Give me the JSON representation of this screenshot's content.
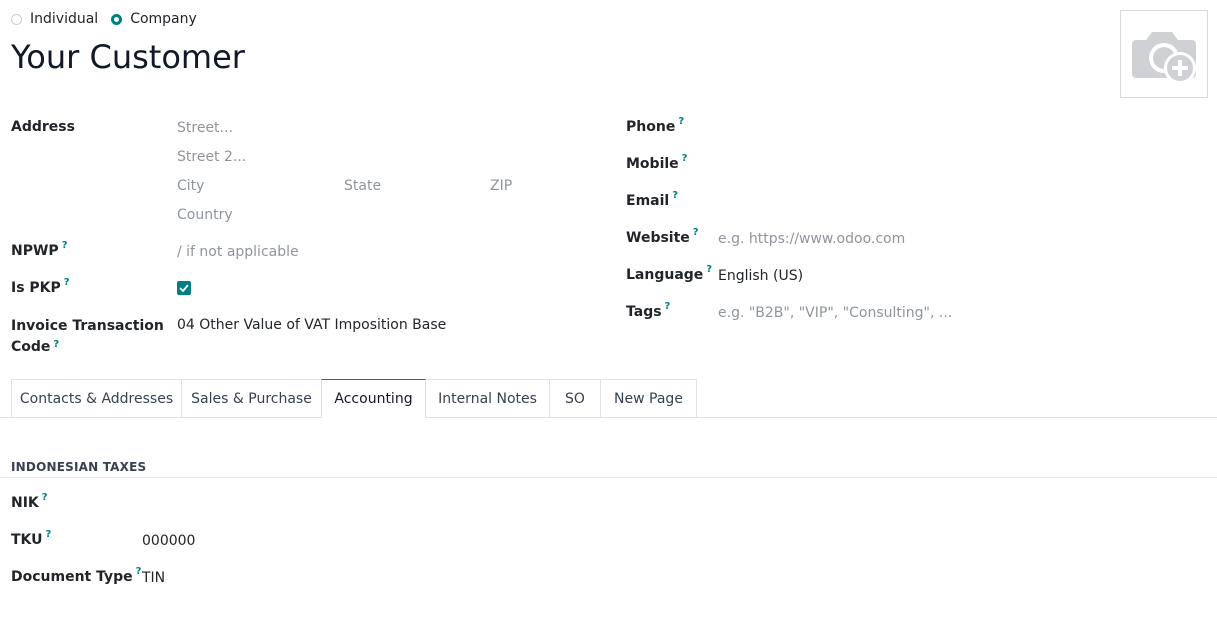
{
  "company_type": {
    "options": [
      {
        "label": "Individual",
        "checked": false
      },
      {
        "label": "Company",
        "checked": true
      }
    ]
  },
  "title": "Your Customer",
  "avatar": {
    "icon": "camera-plus-icon"
  },
  "address": {
    "label": "Address",
    "street_placeholder": "Street...",
    "street2_placeholder": "Street 2...",
    "city_placeholder": "City",
    "state_placeholder": "State",
    "zip_placeholder": "ZIP",
    "country_placeholder": "Country"
  },
  "npwp": {
    "label": "NPWP",
    "help": "?",
    "placeholder": "/ if not applicable"
  },
  "is_pkp": {
    "label": "Is PKP",
    "help": "?",
    "checked": true
  },
  "invoice_code": {
    "label_line1": "Invoice Transaction",
    "label_line2": "Code",
    "help": "?",
    "value": "04 Other Value of VAT Imposition Base"
  },
  "right_fields": {
    "phone": {
      "label": "Phone",
      "help": "?"
    },
    "mobile": {
      "label": "Mobile",
      "help": "?"
    },
    "email": {
      "label": "Email",
      "help": "?"
    },
    "website": {
      "label": "Website",
      "help": "?",
      "placeholder": "e.g. https://www.odoo.com"
    },
    "language": {
      "label": "Language",
      "help": "?",
      "value": "English (US)"
    },
    "tags": {
      "label": "Tags",
      "help": "?",
      "placeholder": "e.g. \"B2B\", \"VIP\", \"Consulting\", ..."
    }
  },
  "tabs": [
    {
      "label": "Contacts & Addresses",
      "active": false
    },
    {
      "label": "Sales & Purchase",
      "active": false
    },
    {
      "label": "Accounting",
      "active": true
    },
    {
      "label": "Internal Notes",
      "active": false
    },
    {
      "label": "SO",
      "active": false
    },
    {
      "label": "New Page",
      "active": false
    }
  ],
  "accounting": {
    "section_title": "INDONESIAN TAXES",
    "nik": {
      "label": "NIK",
      "help": "?"
    },
    "tku": {
      "label": "TKU",
      "help": "?",
      "value": "000000"
    },
    "document_type": {
      "label": "Document Type",
      "help": "?",
      "value": "TIN"
    }
  },
  "colors": {
    "accent": "#017e84",
    "tab_active": "#714b67"
  }
}
